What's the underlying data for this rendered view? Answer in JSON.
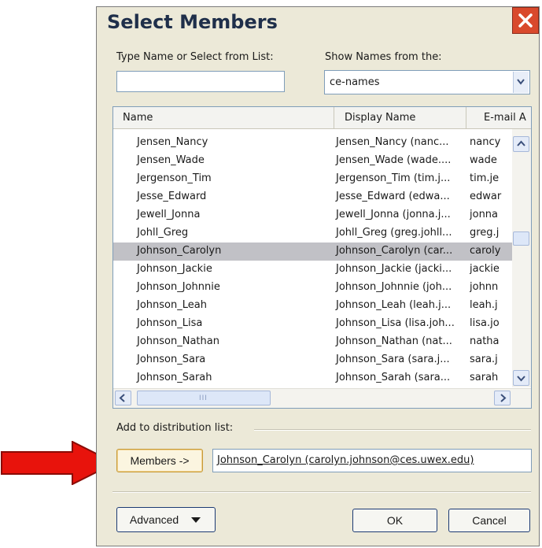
{
  "dialog": {
    "title": "Select Members"
  },
  "search": {
    "label": "Type Name or Select from List:",
    "value": ""
  },
  "source": {
    "label": "Show Names from the:",
    "selected": "ce-names"
  },
  "table": {
    "columns": [
      "Name",
      "Display Name",
      "E-mail A"
    ],
    "rows": [
      {
        "name": "Jensen_Nancy",
        "display": "Jensen_Nancy (nanc...",
        "email": "nancy"
      },
      {
        "name": "Jensen_Wade",
        "display": "Jensen_Wade (wade....",
        "email": "wade"
      },
      {
        "name": "Jergenson_Tim",
        "display": "Jergenson_Tim (tim.j...",
        "email": "tim.je"
      },
      {
        "name": "Jesse_Edward",
        "display": "Jesse_Edward (edwa...",
        "email": "edwar"
      },
      {
        "name": "Jewell_Jonna",
        "display": "Jewell_Jonna (jonna.j...",
        "email": "jonna"
      },
      {
        "name": "Johll_Greg",
        "display": "Johll_Greg (greg.johll...",
        "email": "greg.j"
      },
      {
        "name": "Johnson_Carolyn",
        "display": "Johnson_Carolyn (car...",
        "email": "caroly"
      },
      {
        "name": "Johnson_Jackie",
        "display": "Johnson_Jackie (jacki...",
        "email": "jackie"
      },
      {
        "name": "Johnson_Johnnie",
        "display": "Johnson_Johnnie (joh...",
        "email": "johnn"
      },
      {
        "name": "Johnson_Leah",
        "display": "Johnson_Leah (leah.j...",
        "email": "leah.j"
      },
      {
        "name": "Johnson_Lisa",
        "display": "Johnson_Lisa (lisa.joh...",
        "email": "lisa.jo"
      },
      {
        "name": "Johnson_Nathan",
        "display": "Johnson_Nathan (nat...",
        "email": "natha"
      },
      {
        "name": "Johnson_Sara",
        "display": "Johnson_Sara (sara.j...",
        "email": "sara.j"
      },
      {
        "name": "Johnson_Sarah",
        "display": "Johnson_Sarah (sara...",
        "email": "sarah"
      }
    ],
    "selected_index": 6,
    "scrollbar_grip": "III"
  },
  "distribution": {
    "label": "Add to distribution list:",
    "members_button": "Members ->",
    "members_value": "Johnson_Carolyn (carolyn.johnson@ces.uwex.edu)"
  },
  "buttons": {
    "advanced": "Advanced",
    "ok": "OK",
    "cancel": "Cancel"
  },
  "colors": {
    "dialog_bg": "#ece9d8",
    "selection": "#c1c1c6",
    "close_button": "#d9492c",
    "annotation_arrow": "#e8130c"
  },
  "icons": [
    "close-icon",
    "chevron-down-icon",
    "arrow-up-icon",
    "arrow-down-icon",
    "arrow-left-icon",
    "arrow-right-icon",
    "red-pointer-arrow"
  ]
}
